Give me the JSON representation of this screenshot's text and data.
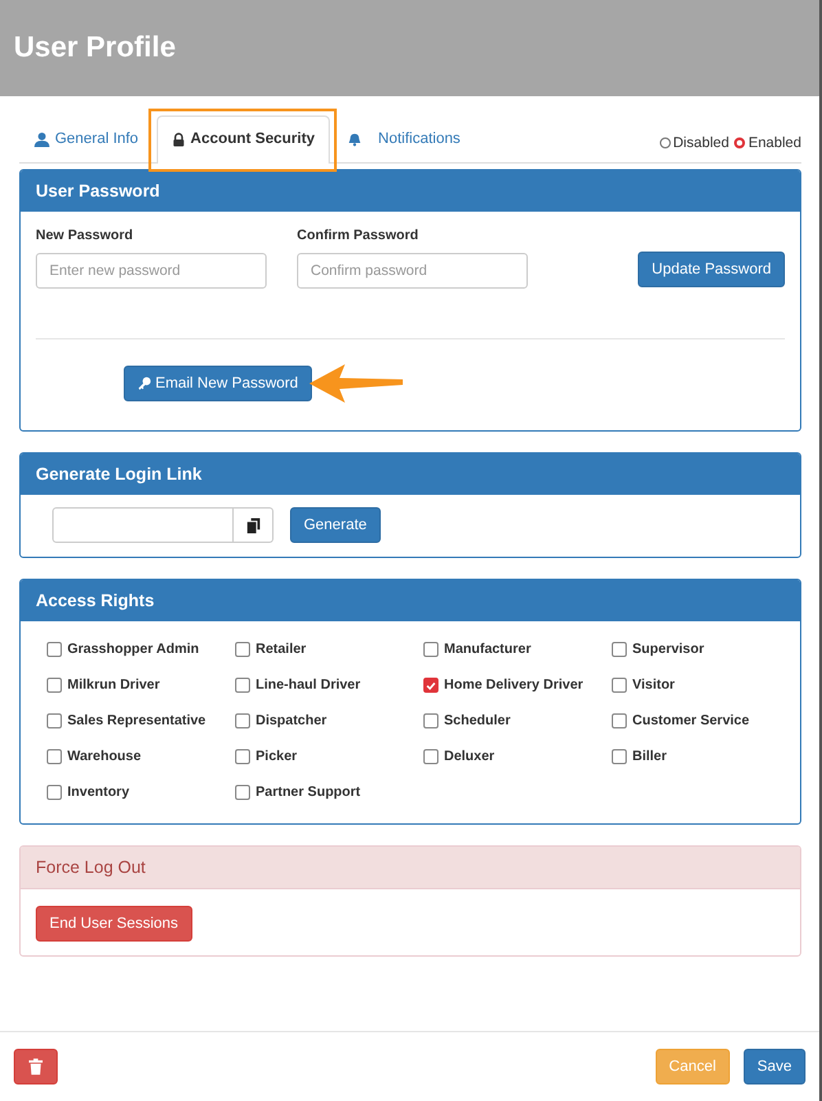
{
  "window": {
    "title": "User Profile"
  },
  "tabs": [
    {
      "label": "General Info",
      "kind": "user",
      "selected": false,
      "highlighted": false
    },
    {
      "label": "Account Security",
      "kind": "lock",
      "selected": true,
      "highlighted": true
    },
    {
      "label": "Notifications",
      "kind": "bell",
      "selected": false,
      "highlighted": false
    }
  ],
  "status": [
    {
      "label": "Disabled",
      "selected": false
    },
    {
      "label": "Enabled",
      "selected": true
    }
  ],
  "password_panel": {
    "title": "User Password",
    "fields": [
      {
        "label": "New Password",
        "placeholder": "Enter new password"
      },
      {
        "label": "Confirm Password",
        "placeholder": "Confirm password"
      }
    ],
    "update_button": "Update Password",
    "email_button": "Email New Password",
    "email_arrow": true
  },
  "login_link_panel": {
    "title": "Generate Login Link",
    "button": "Generate"
  },
  "access_rights": {
    "title": "Access Rights",
    "roles": [
      {
        "label": "Grasshopper Admin",
        "checked": false
      },
      {
        "label": "Retailer",
        "checked": false
      },
      {
        "label": "Manufacturer",
        "checked": false
      },
      {
        "label": "Supervisor",
        "checked": false
      },
      {
        "label": "Milkrun Driver",
        "checked": false
      },
      {
        "label": "Line-haul Driver",
        "checked": false
      },
      {
        "label": "Home Delivery Driver",
        "checked": true
      },
      {
        "label": "Visitor",
        "checked": false
      },
      {
        "label": "Sales Representative",
        "checked": false
      },
      {
        "label": "Dispatcher",
        "checked": false
      },
      {
        "label": "Scheduler",
        "checked": false
      },
      {
        "label": "Customer Service",
        "checked": false
      },
      {
        "label": "Warehouse",
        "checked": false
      },
      {
        "label": "Picker",
        "checked": false
      },
      {
        "label": "Deluxer",
        "checked": false
      },
      {
        "label": "Biller",
        "checked": false
      },
      {
        "label": "Inventory",
        "checked": false
      },
      {
        "label": "Partner Support",
        "checked": false
      }
    ]
  },
  "force_logout": {
    "title": "Force Log Out",
    "button": "End User Sessions"
  },
  "footer": {
    "cancel": "Cancel",
    "save": "Save"
  }
}
